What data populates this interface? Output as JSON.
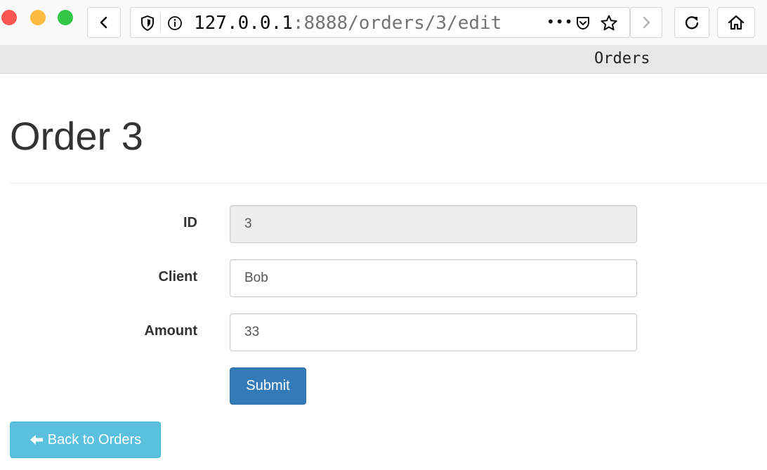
{
  "browser": {
    "url_host": "127.0.0.1",
    "url_path": ":8888/orders/3/edit",
    "more_glyph": "•••",
    "icons": [
      "back-icon",
      "shield-icon",
      "info-icon",
      "pocket-icon",
      "star-icon",
      "forward-icon",
      "reload-icon",
      "home-icon"
    ]
  },
  "navbar": {
    "brand": "Orders"
  },
  "page": {
    "title": "Order 3"
  },
  "form": {
    "id_label": "ID",
    "id_value": "3",
    "client_label": "Client",
    "client_value": "Bob",
    "amount_label": "Amount",
    "amount_value": "33",
    "submit_label": "Submit"
  },
  "back_link": {
    "label": "Back to Orders",
    "icon": "arrow-left-icon"
  },
  "colors": {
    "primary": "#337ab7",
    "info": "#5bc0de",
    "navbar_bg": "#e7e7e7",
    "readonly_bg": "#eeeeee"
  }
}
